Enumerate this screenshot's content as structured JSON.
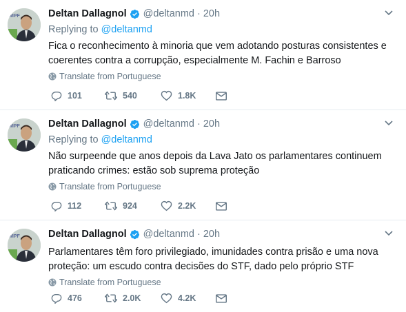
{
  "tweets": [
    {
      "name": "Deltan Dallagnol",
      "handle": "@deltanmd",
      "separator": "·",
      "time": "20h",
      "replying_prefix": "Replying to",
      "replying_to": "@deltanmd",
      "text": "Fica o reconhecimento à minoria que vem adotando posturas consistentes e coerentes contra a corrupção, especialmente M. Fachin e Barroso",
      "translate": "Translate from Portuguese",
      "replies": "101",
      "retweets": "540",
      "likes": "1.8K"
    },
    {
      "name": "Deltan Dallagnol",
      "handle": "@deltanmd",
      "separator": "·",
      "time": "20h",
      "replying_prefix": "Replying to",
      "replying_to": "@deltanmd",
      "text": "Não surpeende que anos depois da Lava Jato os parlamentares continuem praticando crimes: estão sob suprema proteção",
      "translate": "Translate from Portuguese",
      "replies": "112",
      "retweets": "924",
      "likes": "2.2K"
    },
    {
      "name": "Deltan Dallagnol",
      "handle": "@deltanmd",
      "separator": "·",
      "time": "20h",
      "text": "Parlamentares têm foro privilegiado, imunidades contra prisão e uma nova proteção: um escudo contra decisões do STF, dado pelo próprio STF",
      "translate": "Translate from Portuguese",
      "replies": "476",
      "retweets": "2.0K",
      "likes": "4.2K"
    }
  ],
  "avatar_logo": "MPF",
  "colors": {
    "link": "#1da1f2",
    "muted": "#657786",
    "text": "#14171a",
    "divider": "#e6ecf0"
  }
}
